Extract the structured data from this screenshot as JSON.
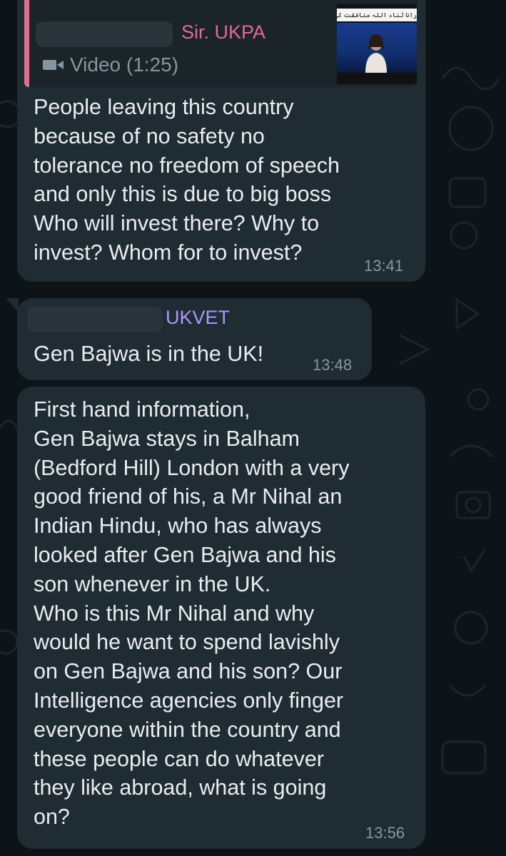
{
  "messages": [
    {
      "reply_quote": {
        "author": "Sir. UKPA",
        "media_label": "Video (1:25)",
        "thumbnail_caption": "رانا ثناء اللہ منافقت کی بوچ خلیفہ ہے"
      },
      "text": "People leaving this country\nbecause of no safety no\ntolerance no freedom of speech\nand only this is due to big boss\nWho will invest there? Why to\ninvest? Whom for to invest?",
      "time": "13:41"
    },
    {
      "sender": "UKVET",
      "text": "Gen Bajwa is in the UK!",
      "time": "13:48"
    },
    {
      "text": "First hand information,\nGen Bajwa stays in Balham\n(Bedford Hill) London with a very\ngood friend of his, a Mr Nihal an\nIndian Hindu, who has always\nlooked after Gen Bajwa and his\nson whenever in the UK.\nWho is this Mr Nihal and why\nwould he want to spend lavishly\non Gen Bajwa and his son? Our\nIntelligence agencies only finger\neveryone within the country and\nthese people can do whatever\nthey like abroad, what is going\non?",
      "time": "13:56"
    }
  ],
  "icons": {
    "video": "video-camera-icon"
  },
  "colors": {
    "background": "#0d1417",
    "bubble": "#202c33",
    "quote_accent": "#e46b8f",
    "sender_name": "#a996ff",
    "meta_text": "#8696a0"
  }
}
